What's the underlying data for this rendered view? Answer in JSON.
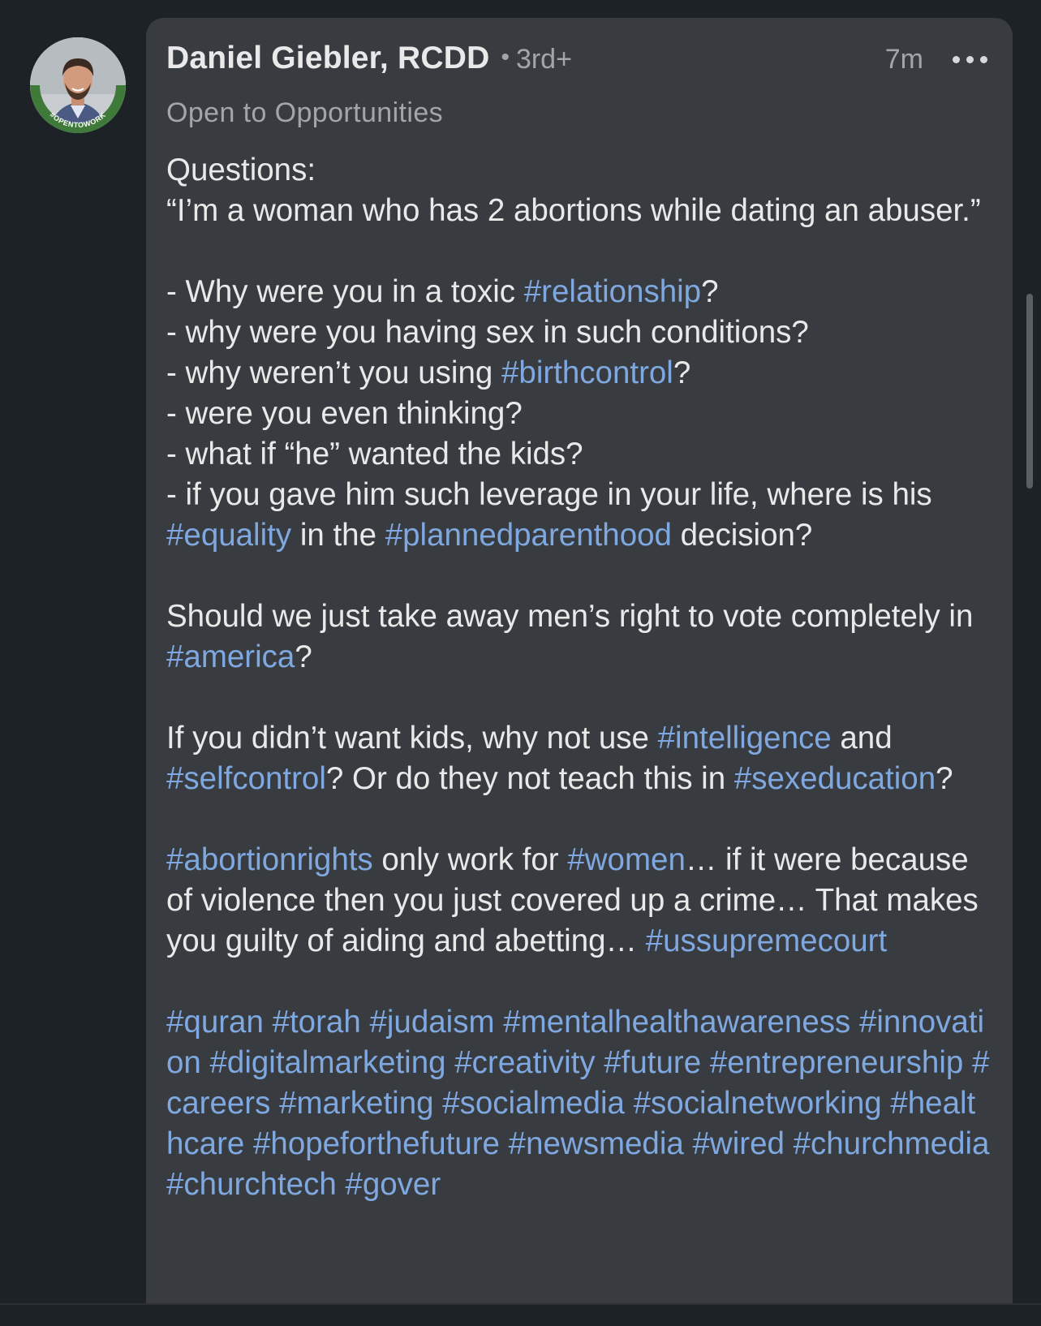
{
  "post": {
    "author": {
      "name": "Daniel Giebler, RCDD",
      "connection_separator": "•",
      "connection_degree": "3rd+",
      "headline": "Open to Opportunities",
      "avatar_badge": "#OPENTOWORK"
    },
    "timestamp": "7m",
    "more_icon": "more-horizontal-icon",
    "body": {
      "intro_label": "Questions:",
      "quote": "“I’m a woman who has 2 abortions while dating an abuser.”",
      "q1_text": "- Why were you in a toxic ",
      "q1_tag": "#relationship",
      "q1_end": "?",
      "q2_text": "- why were you having sex in such conditions?",
      "q3_text": "- why weren’t you using ",
      "q3_tag": "#birthcontrol",
      "q3_end": "?",
      "q4_text": "- were you even thinking?",
      "q5_text": "- what if “he” wanted the kids?",
      "q6_text": "- if you gave him such leverage in your life, where is his ",
      "q6_tag1": "#equality",
      "q6_mid": " in the ",
      "q6_tag2": "#plannedparenthood",
      "q6_end": " decision?",
      "p2_text": "Should we just take away men’s right to vote completely in ",
      "p2_tag": "#america",
      "p2_end": "?",
      "p3_text": "If you didn’t want kids, why not use ",
      "p3_tag1": "#intelligence",
      "p3_mid1": " and ",
      "p3_tag2": "#selfcontrol",
      "p3_mid2": "? Or do they not teach this in ",
      "p3_tag3": "#sexeducation",
      "p3_end": "?",
      "p4_tag1": "#abortionrights",
      "p4_mid1": " only work for ",
      "p4_tag2": "#women",
      "p4_mid2": "… if it were because of violence then you just covered up a crime… That makes you guilty of aiding and abetting… ",
      "p4_tag3": "#ussupremecourt",
      "hashtags": "#quran #torah #judaism #mentalhealthawareness #innovation #digitalmarketing #creativity #future #entrepreneurship #careers #marketing #socialmedia #socialnetworking #healthcare #hopeforthefuture #newsmedia #wired #churchmedia #churchtech #gover"
    }
  },
  "colors": {
    "background": "#1d2226",
    "card": "#383c40",
    "text": "#e9e9e9",
    "secondary_text": "#a3a6a9",
    "hashtag": "#7fa8e0"
  }
}
